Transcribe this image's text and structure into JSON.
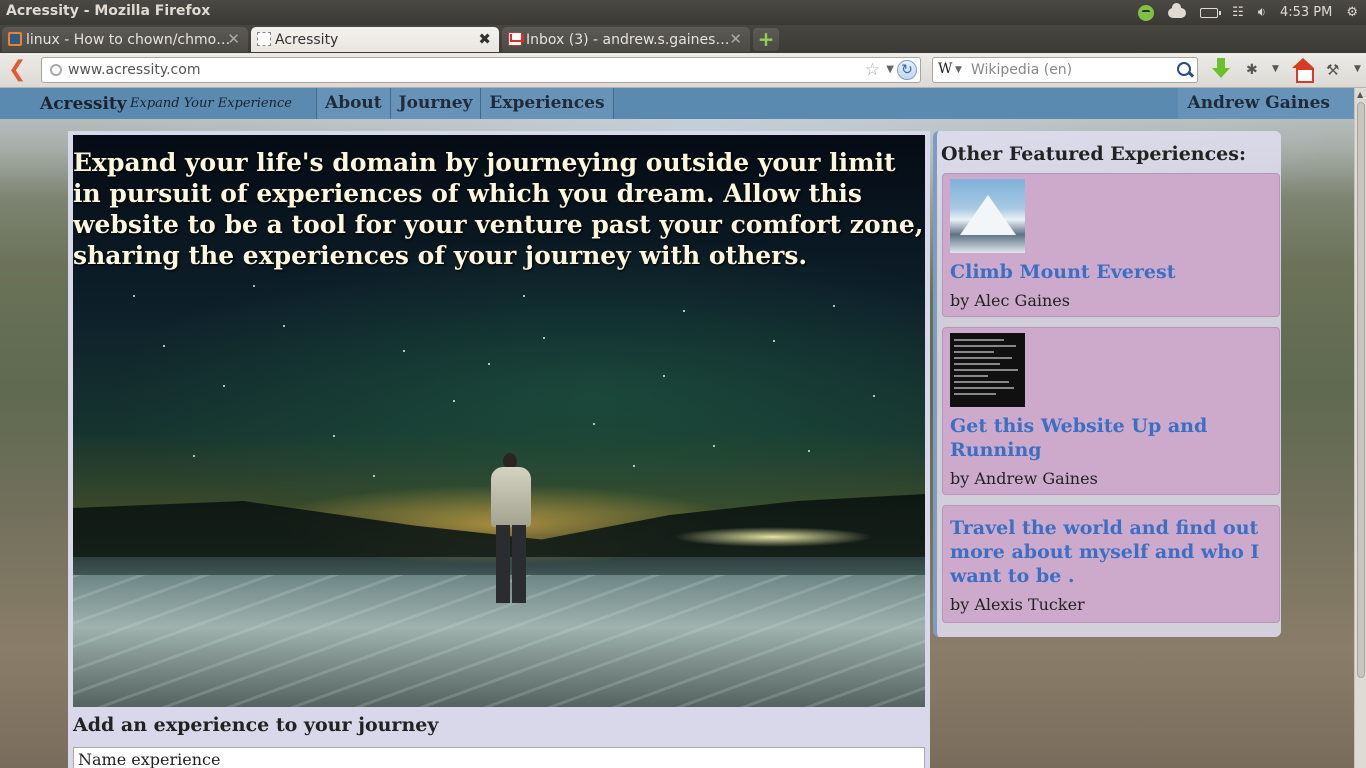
{
  "os": {
    "window_title": "Acressity - Mozilla Firefox",
    "clock": "4:53 PM"
  },
  "tabs": [
    {
      "label": "linux - How to chown/chmo…",
      "active": false
    },
    {
      "label": "Acressity",
      "active": true
    },
    {
      "label": "Inbox (3) - andrew.s.gaines…",
      "active": false
    }
  ],
  "nav": {
    "url": "www.acressity.com",
    "search_placeholder": "Wikipedia (en)",
    "search_engine_glyph": "W"
  },
  "site": {
    "brand": "Acressity",
    "tagline": "Expand Your Experience",
    "menu": [
      "About",
      "Journey",
      "Experiences"
    ],
    "user": "Andrew Gaines"
  },
  "hero": {
    "text": "Expand your life's domain by journeying outside your limit in pursuit of experiences of which you dream. Allow this website to be a tool for your venture past your comfort zone, sharing the experiences of your journey with others."
  },
  "add_form": {
    "heading": "Add an experience to your journey",
    "name_value": "Name experience"
  },
  "sidebar": {
    "title": "Other Featured Experiences:",
    "experiences": [
      {
        "title": "Climb Mount Everest",
        "author": "by Alec Gaines",
        "thumb": "mountain"
      },
      {
        "title": "Get this Website Up and Running",
        "author": "by Andrew Gaines",
        "thumb": "code-screenshot"
      },
      {
        "title": "Travel the world and find out more about myself and who I want to be .",
        "author": "by Alexis Tucker",
        "thumb": null
      }
    ]
  },
  "colors": {
    "header_bar": "#5b8ab0",
    "card_bg": "#cdaacb",
    "link": "#3a6fc4",
    "hero_text": "#fbf6dc"
  }
}
